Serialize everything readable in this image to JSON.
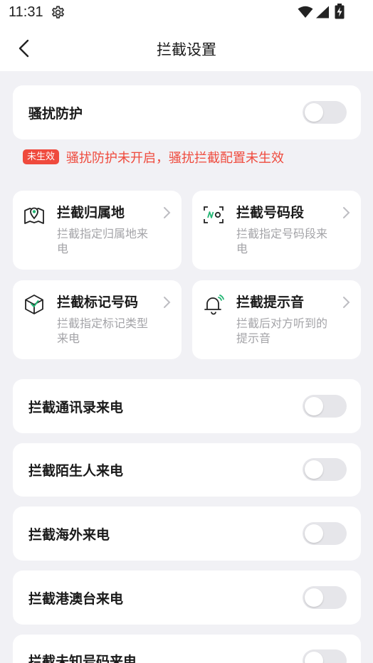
{
  "status_bar": {
    "time": "11:31"
  },
  "header": {
    "title": "拦截设置"
  },
  "harassment": {
    "label": "骚扰防护",
    "enabled": false
  },
  "warning": {
    "badge": "未生效",
    "text": "骚扰防护未开启，骚扰拦截配置未生效",
    "color": "#ef4a3d"
  },
  "grid": [
    {
      "title": "拦截归属地",
      "subtitle": "拦截指定归属地来电",
      "icon": "map-pin-icon"
    },
    {
      "title": "拦截号码段",
      "subtitle": "拦截指定号码段来电",
      "icon": "number-segment-icon"
    },
    {
      "title": "拦截标记号码",
      "subtitle": "拦截指定标记类型来电",
      "icon": "cube-tag-icon"
    },
    {
      "title": "拦截提示音",
      "subtitle": "拦截后对方听到的提示音",
      "icon": "bell-icon"
    }
  ],
  "toggles": [
    {
      "label": "拦截通讯录来电",
      "enabled": false
    },
    {
      "label": "拦截陌生人来电",
      "enabled": false
    },
    {
      "label": "拦截海外来电",
      "enabled": false
    },
    {
      "label": "拦截港澳台来电",
      "enabled": false
    },
    {
      "label": "拦截未知号码来电",
      "enabled": false
    }
  ],
  "colors": {
    "accent_green": "#22b573",
    "background": "#f1f1f5",
    "toggle_off": "#e6e6ea"
  }
}
